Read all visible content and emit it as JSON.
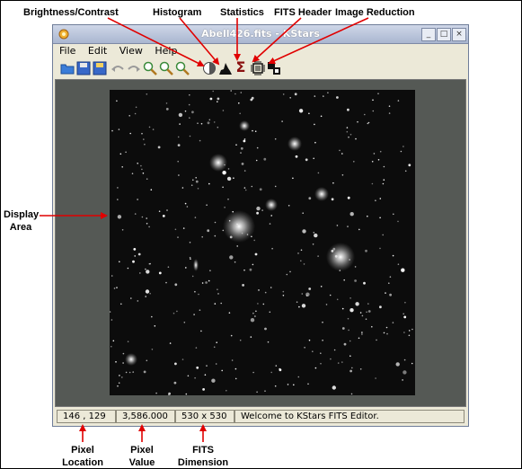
{
  "callouts": {
    "brightness_contrast": "Brightness/Contrast",
    "histogram": "Histogram",
    "statistics": "Statistics",
    "fits_header": "FITS Header",
    "image_reduction": "Image Reduction",
    "display_area_line1": "Display",
    "display_area_line2": "Area",
    "pixel_location_line1": "Pixel",
    "pixel_location_line2": "Location",
    "pixel_value_line1": "Pixel",
    "pixel_value_line2": "Value",
    "fits_dimension_line1": "FITS",
    "fits_dimension_line2": "Dimension"
  },
  "window": {
    "title": "Abell426.fits - KStars",
    "minimize": "_",
    "maximize": "□",
    "close": "×"
  },
  "menu": [
    "File",
    "Edit",
    "View",
    "Help"
  ],
  "toolbar": {
    "icons": [
      "open-icon",
      "save-icon",
      "save-as-icon",
      "undo-icon",
      "redo-icon",
      "zoom-in-icon",
      "zoom-out-icon",
      "zoom-default-icon",
      "brightness-contrast-icon",
      "histogram-icon",
      "statistics-icon",
      "fits-header-icon",
      "image-reduction-icon"
    ],
    "statistics_glyph": "Σ"
  },
  "status": {
    "pixel_location": "146 , 129",
    "pixel_value": "3,586.000",
    "dimension": "530 x 530",
    "message": "Welcome to KStars FITS Editor."
  },
  "colors": {
    "arrow": "#e00000",
    "display_bg": "#555955",
    "image_bg": "#0c0c0c"
  }
}
